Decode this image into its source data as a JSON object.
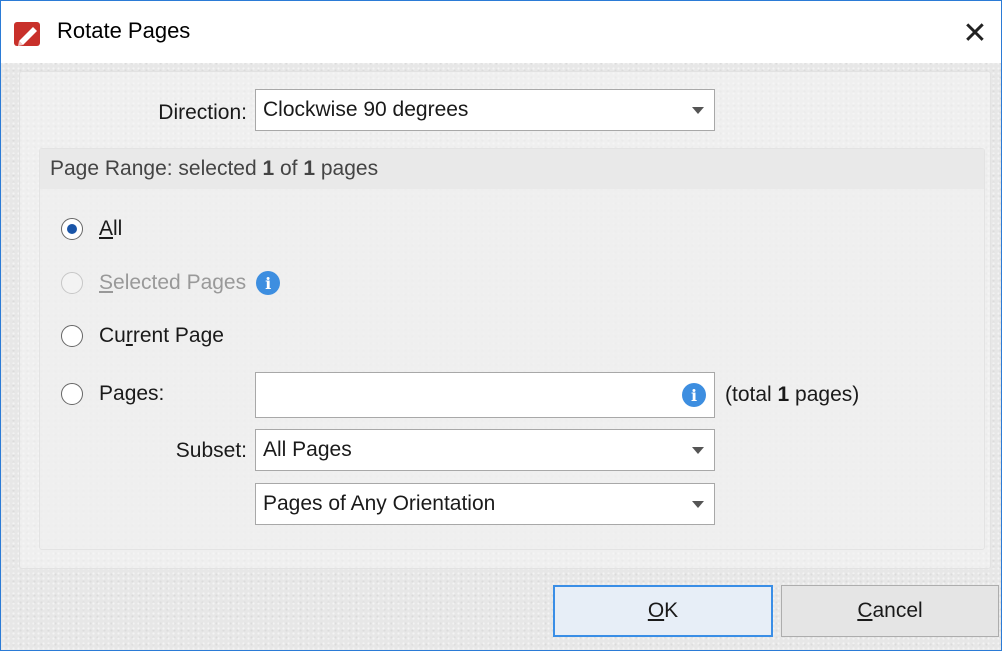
{
  "window": {
    "title": "Rotate Pages",
    "close_glyph": "✕"
  },
  "icons": {
    "app": "pdf-editor-app-icon",
    "info": "info-icon",
    "close": "close-icon"
  },
  "direction": {
    "label": "Direction:",
    "value": "Clockwise 90 degrees"
  },
  "page_range": {
    "header_prefix": "Page Range: selected ",
    "selected": "1",
    "of": " of ",
    "total": "1",
    "suffix": " pages"
  },
  "options": {
    "all": {
      "mnemonic": "A",
      "rest": "ll",
      "checked": true
    },
    "selected_pages": {
      "mnemonic": "S",
      "rest": "elected Pages",
      "enabled": false
    },
    "current_page": {
      "pre": "Cu",
      "mnemonic": "r",
      "rest": "rent Page"
    },
    "pages": {
      "pre": "Pa",
      "mnemonic": "g",
      "rest": "es:",
      "value": ""
    }
  },
  "total_hint": {
    "prefix": "(total ",
    "count": "1",
    "suffix": " pages)"
  },
  "subset": {
    "label": "Subset:",
    "value": "All Pages"
  },
  "orientation": {
    "value": "Pages of Any Orientation"
  },
  "buttons": {
    "ok": {
      "mnemonic": "O",
      "rest": "K"
    },
    "cancel": {
      "mnemonic": "C",
      "rest": "ancel"
    }
  },
  "colors": {
    "accent": "#2b7bd6",
    "info": "#3d8ee0",
    "radio_dot": "#1a55a8",
    "app_icon": "#c8302a"
  }
}
